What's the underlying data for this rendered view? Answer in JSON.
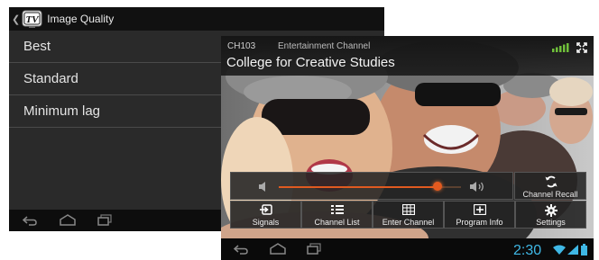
{
  "back_screen": {
    "app_bar": {
      "title": "Image Quality",
      "logo_text": "TV"
    },
    "quality_options": [
      {
        "label": "Best"
      },
      {
        "label": "Standard"
      },
      {
        "label": "Minimum lag"
      }
    ],
    "nav_bar": {
      "buttons": [
        "back-icon",
        "home-icon",
        "recent-apps-icon"
      ]
    }
  },
  "front_screen": {
    "channel": {
      "number": "CH103",
      "name": "Entertainment Channel",
      "program": "College for Creative Studies"
    },
    "signal": {
      "bars": 5,
      "color": "#6fbf3a"
    },
    "volume": {
      "level": 0.87,
      "accent_color": "#e35a1f"
    },
    "buttons": {
      "channel_recall": "Channel Recall",
      "signals": "Signals",
      "channel_list": "Channel List",
      "enter_channel": "Enter Channel",
      "program_info": "Program Info",
      "settings": "Settings"
    },
    "status_bar": {
      "time": "2:30",
      "time_color": "#3fb8e6"
    }
  }
}
